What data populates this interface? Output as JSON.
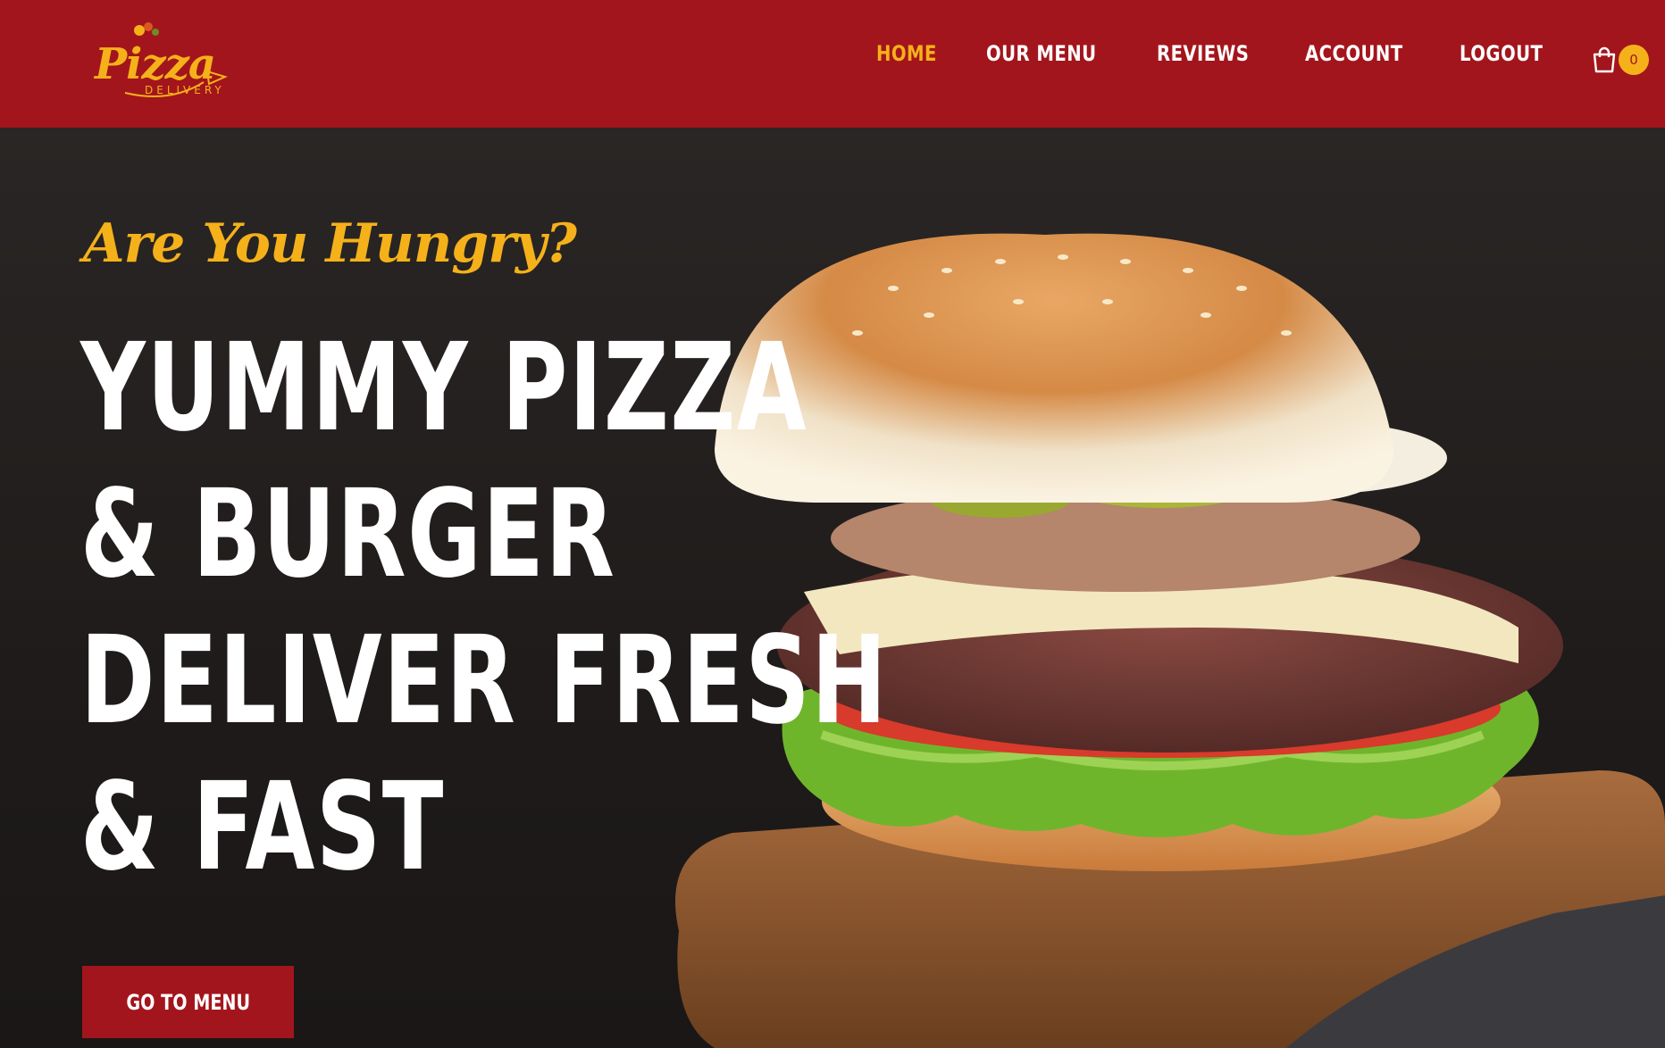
{
  "brand": {
    "logo_text": "Pizza",
    "logo_subtext": "DELIVERY",
    "colors": {
      "primary": "#a3151c",
      "accent": "#f5b11a",
      "text": "#ffffff"
    }
  },
  "nav": {
    "items": [
      {
        "label": "HOME",
        "active": true
      },
      {
        "label": "OUR MENU",
        "active": false
      },
      {
        "label": "REVIEWS",
        "active": false
      },
      {
        "label": "ACCOUNT",
        "active": false
      },
      {
        "label": "LOGOUT",
        "active": false
      }
    ],
    "cart": {
      "icon": "shopping-bag-icon",
      "count": "0"
    }
  },
  "hero": {
    "tagline": "Are You Hungry?",
    "headline_lines": [
      "YUMMY PIZZA",
      "& BURGER",
      "DELIVER FRESH",
      "& FAST"
    ],
    "cta_label": "GO TO MENU",
    "image": "burger-photo"
  }
}
